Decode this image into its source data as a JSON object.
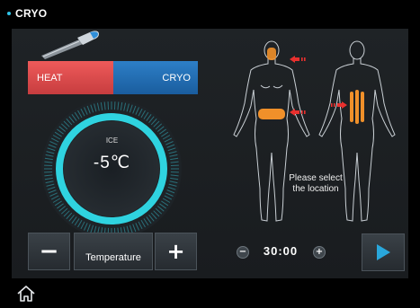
{
  "app": {
    "title": "CRYO"
  },
  "mode": {
    "heat_label": "HEAT",
    "cryo_label": "CRYO",
    "active": "CRYO"
  },
  "dial": {
    "mode_label": "ICE",
    "temperature": "-5℃",
    "level_fraction": 1.0,
    "accent": "#2fd3e0"
  },
  "temp_controls": {
    "minus_label": "−",
    "label": "Temperature",
    "plus_label": "+"
  },
  "body_map": {
    "prompt_line1": "Please select",
    "prompt_line2": "the location",
    "highlight_color": "#f0902a",
    "arrow_color": "#e8302e"
  },
  "timer": {
    "value": "30:00",
    "minus_label": "−",
    "plus_label": "+"
  },
  "icons": {
    "home": "home-icon",
    "play": "play-icon",
    "probe": "probe-icon"
  },
  "colors": {
    "heat": "#e24b4d",
    "cryo": "#2270b6",
    "play": "#29a7db"
  }
}
